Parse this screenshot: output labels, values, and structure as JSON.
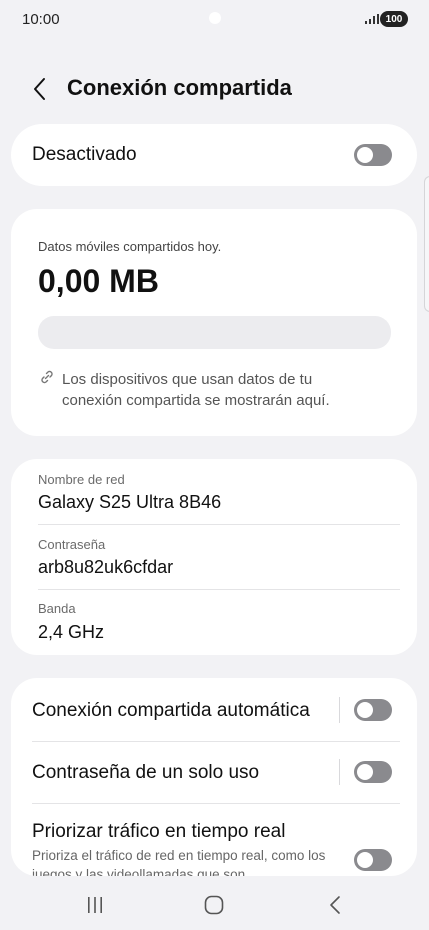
{
  "status": {
    "time": "10:00",
    "battery": "100"
  },
  "header": {
    "title": "Conexión compartida"
  },
  "main_switch": {
    "label": "Desactivado",
    "on": false
  },
  "usage": {
    "caption": "Datos móviles compartidos hoy.",
    "amount": "0,00 MB",
    "progress": 0,
    "note": "Los dispositivos que usan datos de tu conexión compartida se mostrarán aquí."
  },
  "network": {
    "name_label": "Nombre de red",
    "name_value": "Galaxy S25 Ultra 8B46",
    "password_label": "Contraseña",
    "password_value": "arb8u82uk6cfdar",
    "band_label": "Banda",
    "band_value": "2,4 GHz"
  },
  "options": {
    "auto_label": "Conexión compartida automática",
    "auto_on": false,
    "otp_label": "Contraseña de un solo uso",
    "otp_on": false,
    "priority_label": "Priorizar tráfico en tiempo real",
    "priority_desc": "Prioriza el tráfico de red en tiempo real, como los juegos y las videollamadas que son",
    "priority_on": false
  },
  "colors": {
    "background": "#f2f2f5",
    "card": "#ffffff",
    "toggle_off": "#8a8a8e"
  },
  "icons": {
    "signal": "signal-icon",
    "back": "chevron-left-icon",
    "link": "link-icon",
    "recents": "recents-icon",
    "home": "home-icon",
    "nav_back": "nav-back-icon"
  }
}
